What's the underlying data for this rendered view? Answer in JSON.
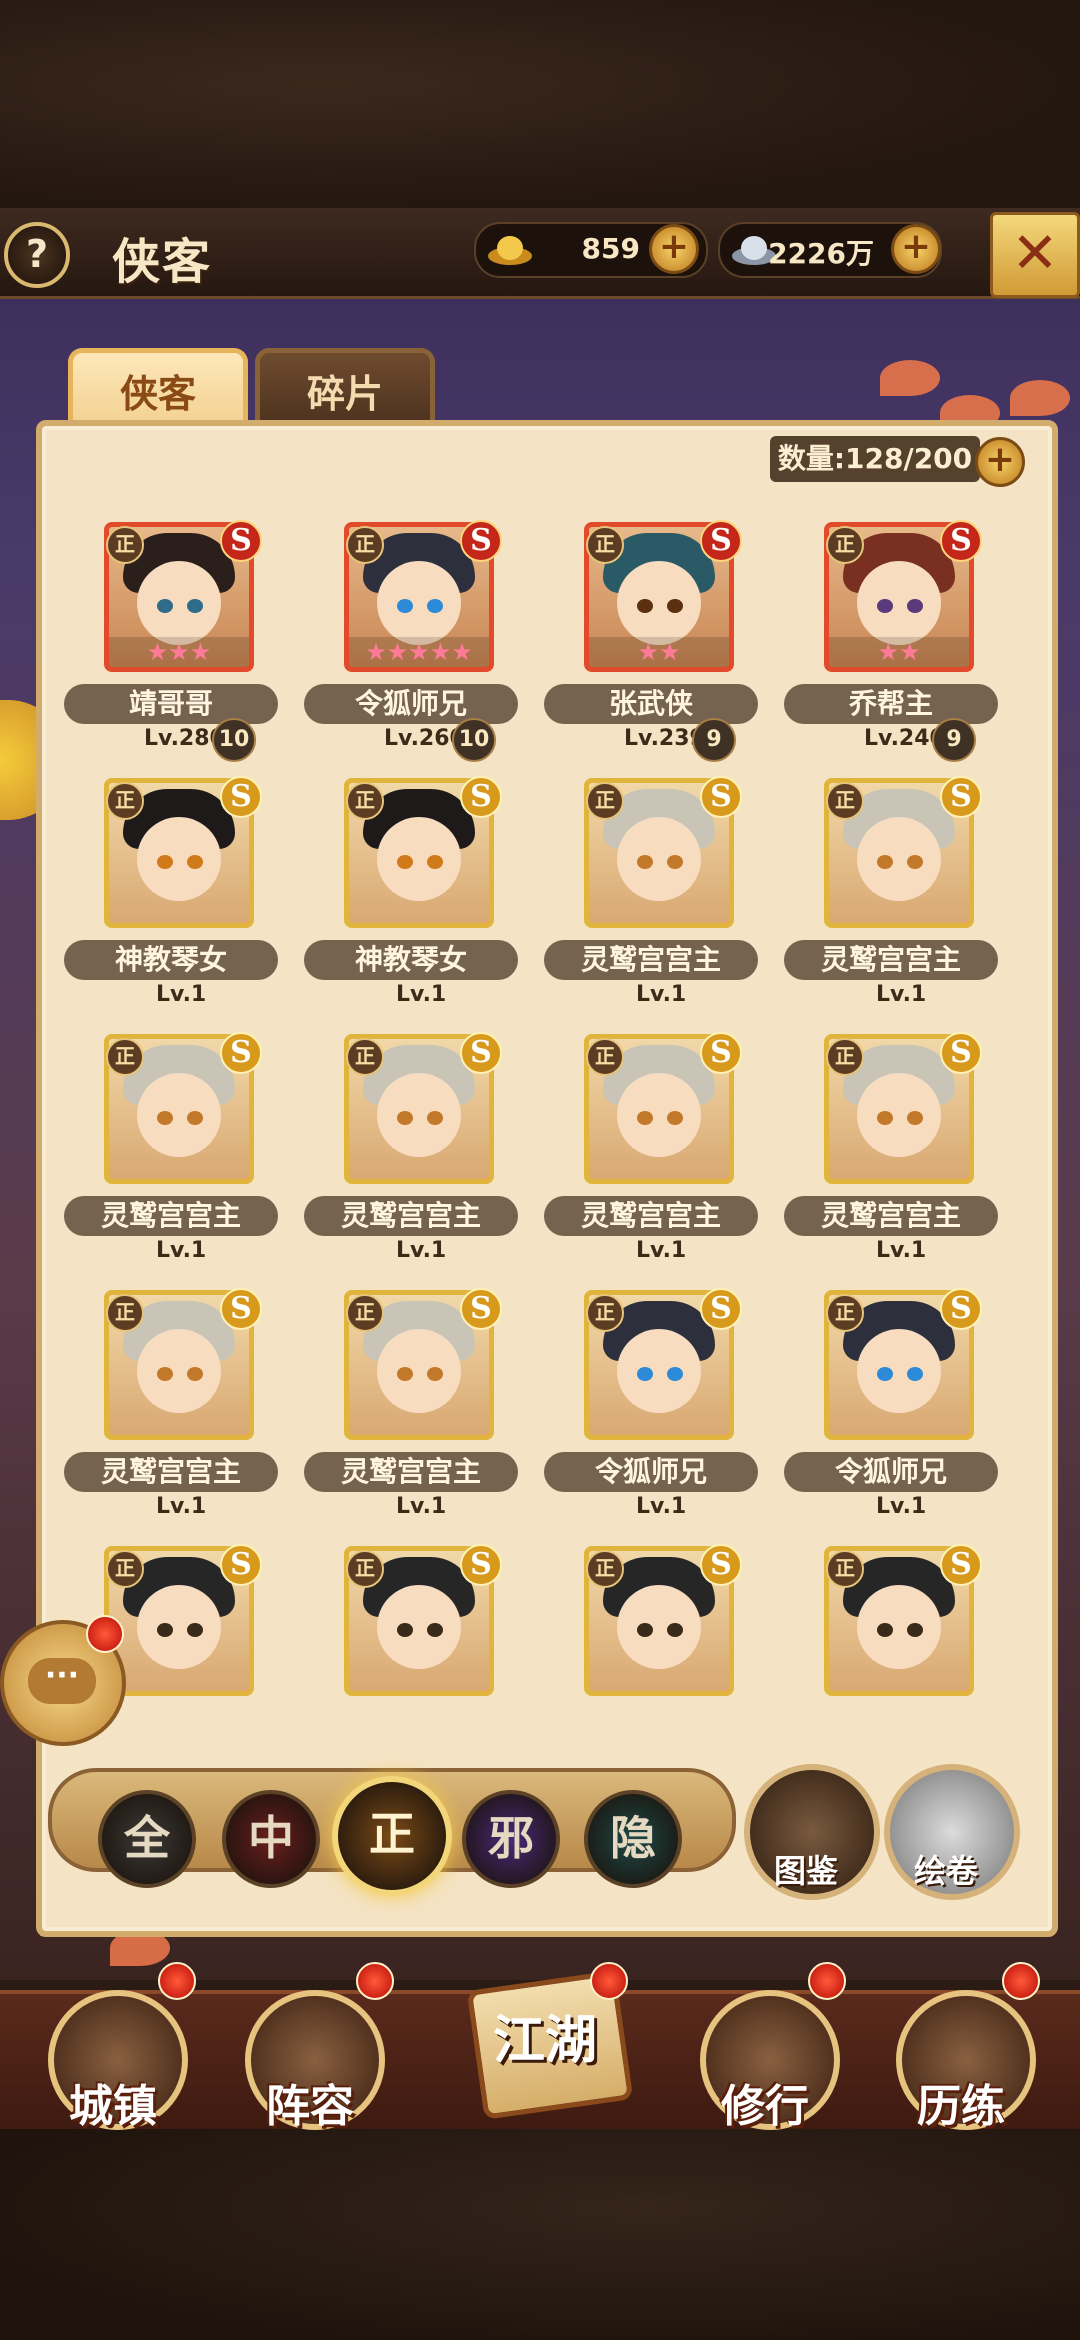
{
  "header": {
    "help_label": "?",
    "title": "侠客",
    "gold_value": "859",
    "silver_value": "2226万",
    "plus_label": "+",
    "close_label": "✕"
  },
  "tabs": [
    {
      "label": "侠客",
      "active": true
    },
    {
      "label": "碎片",
      "active": false
    }
  ],
  "count_label": "数量:128/200",
  "heroes": [
    {
      "name": "靖哥哥",
      "lv": "Lv.280",
      "stars": "★★★",
      "stone": "10",
      "rank": "S",
      "tier": "red",
      "faction": "正",
      "hair": "#2b1f1c",
      "eye": "#2e6c8a"
    },
    {
      "name": "令狐师兄",
      "lv": "Lv.260",
      "stars": "★★★★★",
      "stone": "10",
      "rank": "S",
      "tier": "red",
      "faction": "正",
      "hair": "#2d2f3d",
      "eye": "#2d8ad6"
    },
    {
      "name": "张武侠",
      "lv": "Lv.239",
      "stars": "★★",
      "stone": "9",
      "rank": "S",
      "tier": "red",
      "faction": "正",
      "hair": "#2a5a66",
      "eye": "#5a3010"
    },
    {
      "name": "乔帮主",
      "lv": "Lv.240",
      "stars": "★★",
      "stone": "9",
      "rank": "S",
      "tier": "red",
      "faction": "正",
      "hair": "#7a3020",
      "eye": "#5a3a7a"
    },
    {
      "name": "神教琴女",
      "lv": "Lv.1",
      "stars": "",
      "stone": "",
      "rank": "S",
      "tier": "gold",
      "faction": "正",
      "hair": "#1e1a1a",
      "eye": "#d07a1a"
    },
    {
      "name": "神教琴女",
      "lv": "Lv.1",
      "stars": "",
      "stone": "",
      "rank": "S",
      "tier": "gold",
      "faction": "正",
      "hair": "#1e1a1a",
      "eye": "#d07a1a"
    },
    {
      "name": "灵鹫宫宫主",
      "lv": "Lv.1",
      "stars": "",
      "stone": "",
      "rank": "S",
      "tier": "gold",
      "faction": "正",
      "hair": "#c9c4b6",
      "eye": "#c27a2a"
    },
    {
      "name": "灵鹫宫宫主",
      "lv": "Lv.1",
      "stars": "",
      "stone": "",
      "rank": "S",
      "tier": "gold",
      "faction": "正",
      "hair": "#c9c4b6",
      "eye": "#c27a2a"
    },
    {
      "name": "灵鹫宫宫主",
      "lv": "Lv.1",
      "stars": "",
      "stone": "",
      "rank": "S",
      "tier": "gold",
      "faction": "正",
      "hair": "#c9c4b6",
      "eye": "#c27a2a"
    },
    {
      "name": "灵鹫宫宫主",
      "lv": "Lv.1",
      "stars": "",
      "stone": "",
      "rank": "S",
      "tier": "gold",
      "faction": "正",
      "hair": "#c9c4b6",
      "eye": "#c27a2a"
    },
    {
      "name": "灵鹫宫宫主",
      "lv": "Lv.1",
      "stars": "",
      "stone": "",
      "rank": "S",
      "tier": "gold",
      "faction": "正",
      "hair": "#c9c4b6",
      "eye": "#c27a2a"
    },
    {
      "name": "灵鹫宫宫主",
      "lv": "Lv.1",
      "stars": "",
      "stone": "",
      "rank": "S",
      "tier": "gold",
      "faction": "正",
      "hair": "#c9c4b6",
      "eye": "#c27a2a"
    },
    {
      "name": "灵鹫宫宫主",
      "lv": "Lv.1",
      "stars": "",
      "stone": "",
      "rank": "S",
      "tier": "gold",
      "faction": "正",
      "hair": "#c9c4b6",
      "eye": "#c27a2a"
    },
    {
      "name": "灵鹫宫宫主",
      "lv": "Lv.1",
      "stars": "",
      "stone": "",
      "rank": "S",
      "tier": "gold",
      "faction": "正",
      "hair": "#c9c4b6",
      "eye": "#c27a2a"
    },
    {
      "name": "令狐师兄",
      "lv": "Lv.1",
      "stars": "",
      "stone": "",
      "rank": "S",
      "tier": "gold",
      "faction": "正",
      "hair": "#2d2f3d",
      "eye": "#2d8ad6"
    },
    {
      "name": "令狐师兄",
      "lv": "Lv.1",
      "stars": "",
      "stone": "",
      "rank": "S",
      "tier": "gold",
      "faction": "正",
      "hair": "#2d2f3d",
      "eye": "#2d8ad6"
    },
    {
      "name": "",
      "lv": "",
      "stars": "",
      "stone": "",
      "rank": "S",
      "tier": "gold",
      "faction": "正",
      "hair": "#262626",
      "eye": "#3a2a1a"
    },
    {
      "name": "",
      "lv": "",
      "stars": "",
      "stone": "",
      "rank": "S",
      "tier": "gold",
      "faction": "正",
      "hair": "#262626",
      "eye": "#3a2a1a"
    },
    {
      "name": "",
      "lv": "",
      "stars": "",
      "stone": "",
      "rank": "S",
      "tier": "gold",
      "faction": "正",
      "hair": "#262626",
      "eye": "#3a2a1a"
    },
    {
      "name": "",
      "lv": "",
      "stars": "",
      "stone": "",
      "rank": "S",
      "tier": "gold",
      "faction": "正",
      "hair": "#262626",
      "eye": "#3a2a1a"
    }
  ],
  "filters": [
    {
      "label": "全",
      "active": false,
      "color": "#3d3a36"
    },
    {
      "label": "中",
      "active": false,
      "color": "#6a1e1e"
    },
    {
      "label": "正",
      "active": true,
      "color": "#7a4a16"
    },
    {
      "label": "邪",
      "active": false,
      "color": "#4a2a78"
    },
    {
      "label": "隐",
      "active": false,
      "color": "#1f4a48"
    }
  ],
  "side_buttons": [
    {
      "label": "图鉴"
    },
    {
      "label": "绘卷"
    }
  ],
  "chat_label": "···",
  "nav": [
    {
      "label": "城镇"
    },
    {
      "label": "阵容"
    },
    {
      "label": "江湖"
    },
    {
      "label": "修行"
    },
    {
      "label": "历练"
    }
  ]
}
